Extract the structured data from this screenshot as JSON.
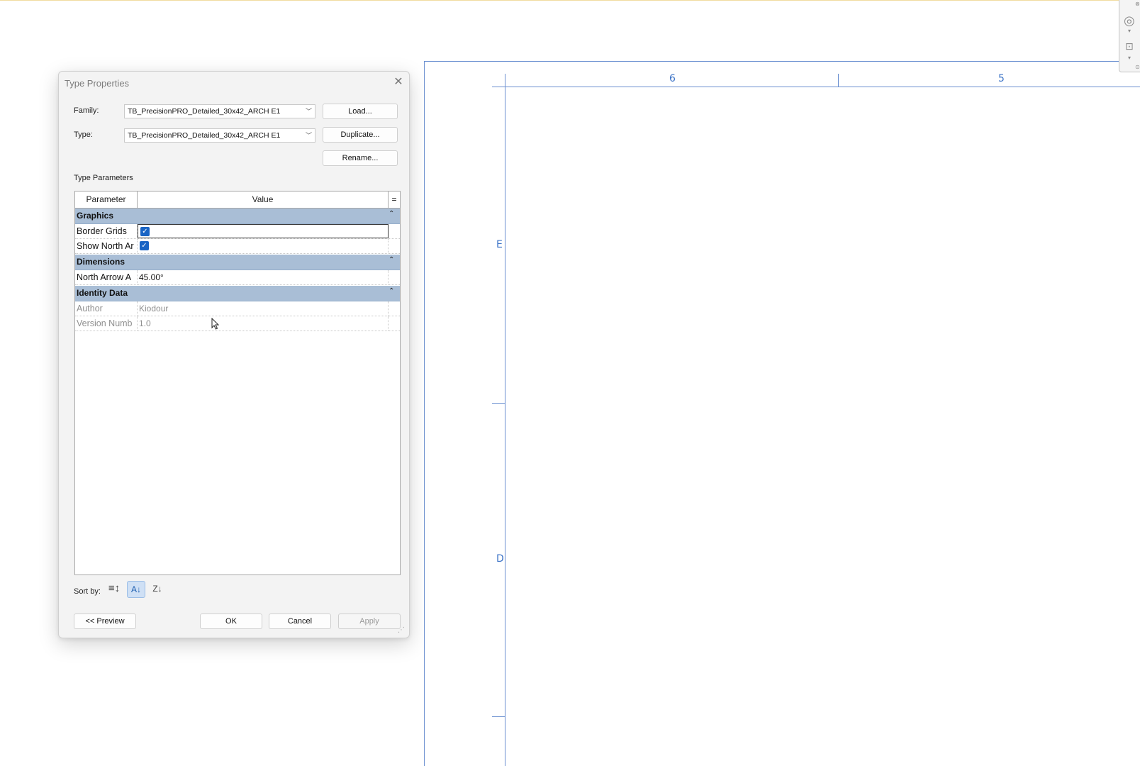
{
  "canvas": {
    "grid_labels_top": [
      "6",
      "5"
    ],
    "grid_labels_left": [
      "E",
      "D"
    ]
  },
  "navbar": {
    "icons": [
      "steering-wheel-icon",
      "zoom-icon"
    ]
  },
  "dialog": {
    "title": "Type Properties",
    "family_label": "Family:",
    "family_value": "TB_PrecisionPRO_Detailed_30x42_ARCH E1",
    "type_label": "Type:",
    "type_value": "TB_PrecisionPRO_Detailed_30x42_ARCH E1",
    "load_label": "Load...",
    "duplicate_label": "Duplicate...",
    "rename_label": "Rename...",
    "type_parameters_label": "Type Parameters",
    "table": {
      "col_parameter": "Parameter",
      "col_value": "Value",
      "col_extra": "=",
      "groups": [
        {
          "name": "Graphics",
          "rows": [
            {
              "parameter": "Border Grids",
              "value": "",
              "checked": true
            },
            {
              "parameter": "Show North Ar",
              "value": "",
              "checked": true
            }
          ]
        },
        {
          "name": "Dimensions",
          "rows": [
            {
              "parameter": "North Arrow A",
              "value": "45.00°"
            }
          ]
        },
        {
          "name": "Identity Data",
          "rows": [
            {
              "parameter": "Author",
              "value": "Kiodour"
            },
            {
              "parameter": "Version Numb",
              "value": "1.0"
            }
          ]
        }
      ]
    },
    "sort_by_label": "Sort by:",
    "preview_label": "<< Preview",
    "ok_label": "OK",
    "cancel_label": "Cancel",
    "apply_label": "Apply"
  },
  "colors": {
    "group_header": "#a9bed6",
    "checkbox": "#1964c4",
    "grid_line": "#6a8fd0"
  }
}
